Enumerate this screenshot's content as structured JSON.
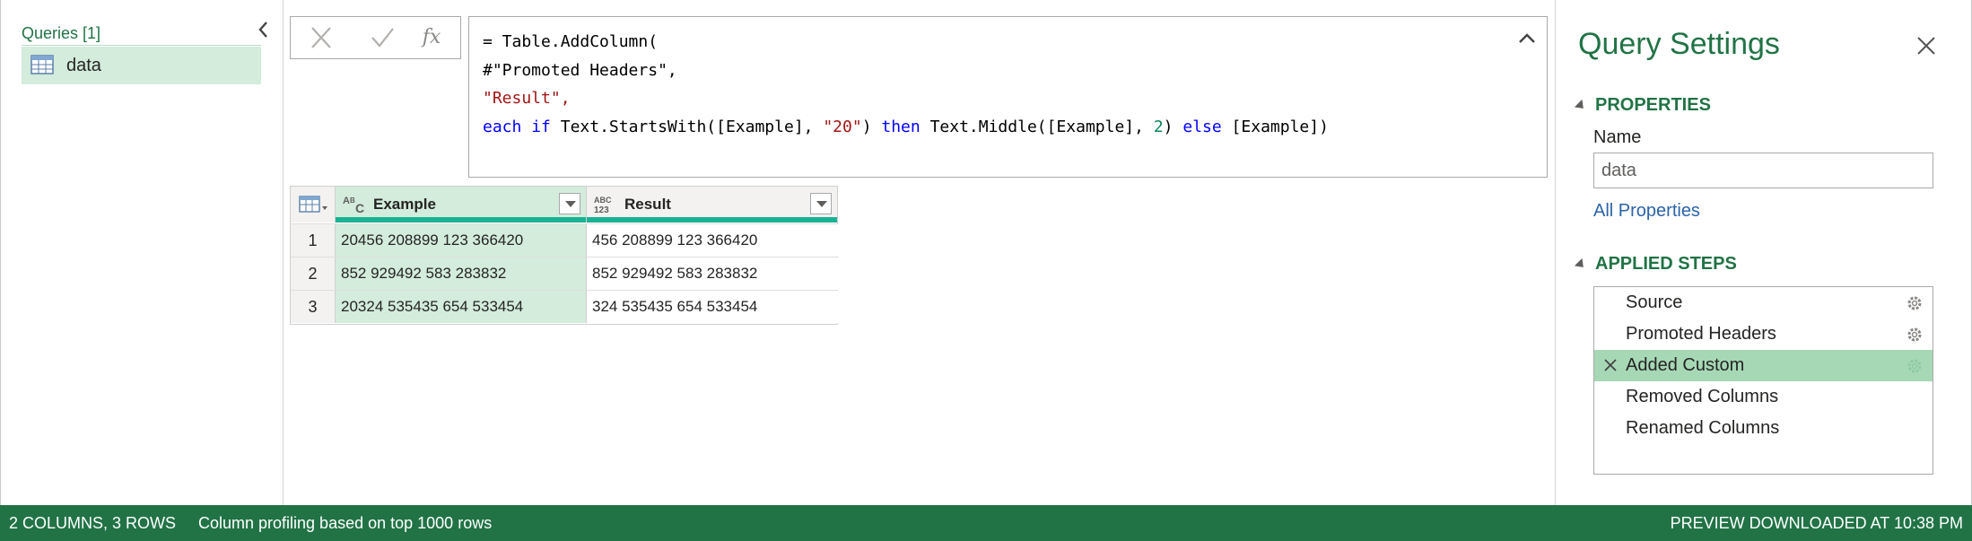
{
  "queries": {
    "title": "Queries [1]",
    "items": [
      {
        "label": "data",
        "icon": "table-icon"
      }
    ]
  },
  "formula": {
    "cancel_icon": "close-icon",
    "commit_icon": "check-icon",
    "fx_label": "fx",
    "lines": [
      "= Table.AddColumn(",
      "#\"Promoted Headers\",",
      "\"Result\",",
      "each if Text.StartsWith([Example], \"20\") then Text.Middle([Example], 2) else [Example])"
    ]
  },
  "grid": {
    "columns": [
      {
        "name": "Example",
        "type_icon": "text-type-icon",
        "type_label": "ABC"
      },
      {
        "name": "Result",
        "type_icon": "any-type-icon",
        "type_label": "ABC 123"
      }
    ],
    "rows": [
      {
        "num": "1",
        "example": "20456 208899 123 366420",
        "result": "456 208899 123 366420"
      },
      {
        "num": "2",
        "example": "852 929492 583 283832",
        "result": "852 929492 583 283832"
      },
      {
        "num": "3",
        "example": "20324 535435 654 533454",
        "result": "324 535435 654 533454"
      }
    ]
  },
  "settings": {
    "title": "Query Settings",
    "properties_heading": "PROPERTIES",
    "name_label": "Name",
    "name_value": "data",
    "all_properties": "All Properties",
    "steps_heading": "APPLIED STEPS",
    "steps": [
      {
        "label": "Source",
        "gear": true,
        "active": false
      },
      {
        "label": "Promoted Headers",
        "gear": true,
        "active": false
      },
      {
        "label": "Added Custom",
        "gear": true,
        "active": true
      },
      {
        "label": "Removed Columns",
        "gear": false,
        "active": false
      },
      {
        "label": "Renamed Columns",
        "gear": false,
        "active": false
      }
    ]
  },
  "status": {
    "summary": "2 COLUMNS, 3 ROWS",
    "profiling": "Column profiling based on top 1000 rows",
    "preview": "PREVIEW DOWNLOADED AT 10:38 PM"
  },
  "colors": {
    "accent_green": "#217346",
    "selection_green": "#d3ecdc",
    "active_step": "#a6d8b6",
    "column_quality_bar": "#19b394"
  }
}
